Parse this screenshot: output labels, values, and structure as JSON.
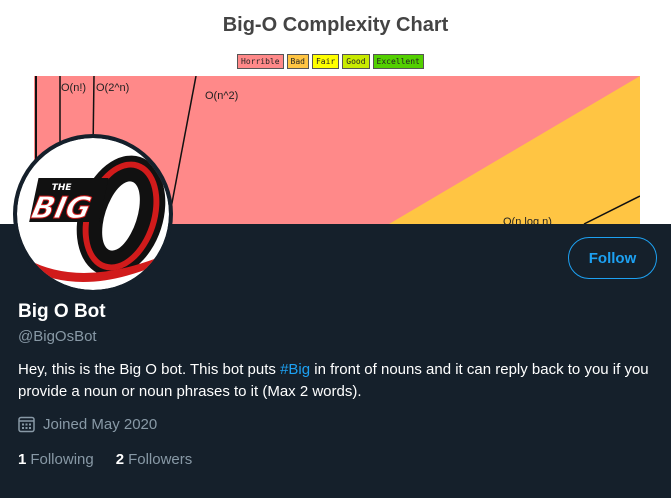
{
  "banner": {
    "title": "Big-O Complexity Chart",
    "legend": [
      {
        "label": "Horrible",
        "color": "#ff8989"
      },
      {
        "label": "Bad",
        "color": "#ffc543"
      },
      {
        "label": "Fair",
        "color": "#ffff00"
      },
      {
        "label": "Good",
        "color": "#c8ea00"
      },
      {
        "label": "Excellent",
        "color": "#53d000"
      }
    ],
    "curve_labels": [
      "O(n!)",
      "O(2^n)",
      "O(n^2)",
      "O(n log n)"
    ]
  },
  "avatar": {
    "alt_text": "THE BIG O"
  },
  "follow_label": "Follow",
  "profile": {
    "display_name": "Big O Bot",
    "handle": "@BigOsBot",
    "bio_before": "Hey, this is the Big O bot. This bot puts ",
    "bio_hashtag": "#Big",
    "bio_after": " in front of nouns and it can reply back to you if you provide a noun or noun phrases to it (Max 2 words).",
    "joined": "Joined May 2020",
    "following_count": "1",
    "following_label": "Following",
    "followers_count": "2",
    "followers_label": "Followers"
  },
  "colors": {
    "background": "#15202b",
    "accent": "#1da1f2",
    "secondary_text": "#8899a6"
  }
}
